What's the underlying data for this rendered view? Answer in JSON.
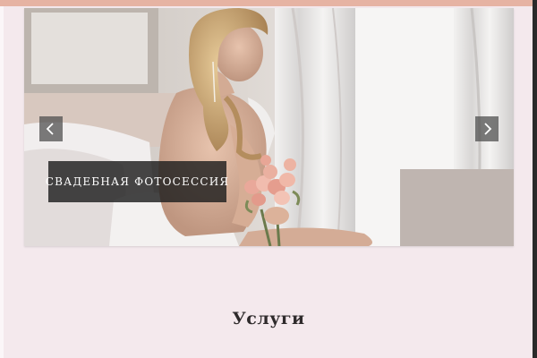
{
  "slider": {
    "caption": "СВАДЕБНАЯ ФОТОСЕССИЯ",
    "prev_icon": "chevron-left-icon",
    "next_icon": "chevron-right-icon"
  },
  "services": {
    "title": "Услуги"
  },
  "colors": {
    "page_background": "#f4e9ed",
    "top_strip": "#e6b3a3",
    "caption_background": "#1e1e1e",
    "caption_text": "#ffffff",
    "arrow_background": "#505050"
  }
}
